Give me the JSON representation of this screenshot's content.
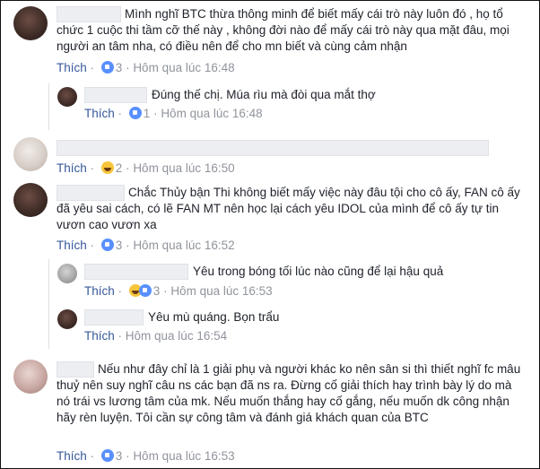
{
  "like_label": "Thích",
  "comments": [
    {
      "text": "Mình nghĩ BTC thừa thông minh để biết mấy cái trò này luôn đó , họ tổ chức 1 cuộc thi tầm cỡ thế này , không đời nào để mấy cái trò này qua mặt đâu, mọi người an tâm nha, có điều nên để cho mn biết và cùng cảm nhận",
      "count": "3",
      "time": "Hôm qua lúc 16:48",
      "reaction": "like"
    },
    {
      "text": "Đúng thế chị. Múa rìu mà đòi qua mắt thợ",
      "count": "1",
      "time": "Hôm qua lúc 16:48",
      "reaction": "like"
    },
    {
      "text": "",
      "count": "2",
      "time": "Hôm qua lúc 16:50",
      "reaction": "haha"
    },
    {
      "text": "Chắc Thủy bận Thi không biết mấy việc này đâu tội cho cô ấy, FAN cô ấy đã yêu sai cách, có lẽ FAN MT nên học lại cách yêu IDOL của mình để cô ấy tự tin vươn cao vươn xa",
      "count": "3",
      "time": "Hôm qua lúc 16:52",
      "reaction": "like"
    },
    {
      "text": "Yêu trong bóng tối lúc nào cũng để lại hậu quả",
      "count": "3",
      "time": "Hôm qua lúc 16:53",
      "reaction": "haha+like"
    },
    {
      "text": "Yêu mù quáng. Bọn trẩu",
      "count": "",
      "time": "Hôm qua lúc 16:54",
      "reaction": "none"
    },
    {
      "text": "Nếu như đây chỉ là 1 giải phụ và người khác ko nên sân si thì thiết nghĩ fc mâu thuỷ nên suy nghĩ câu ns các bạn đã ns ra. Đừng cố giải thích hay trình bày lý do mà nó trái vs lương tâm của mk. Nếu muốn thắng hay cố gắng, nếu muốn dk công nhận hãy rèn luyện. Tôi cần sự công tâm và đánh giá khách quan của BTC",
      "count": "3",
      "time": "Hôm qua lúc 16:53",
      "reaction": "like"
    }
  ],
  "colors": {
    "link": "#365899",
    "meta": "#90949c",
    "like_icon": "#5890ff",
    "haha_icon": "#f7c53a"
  }
}
